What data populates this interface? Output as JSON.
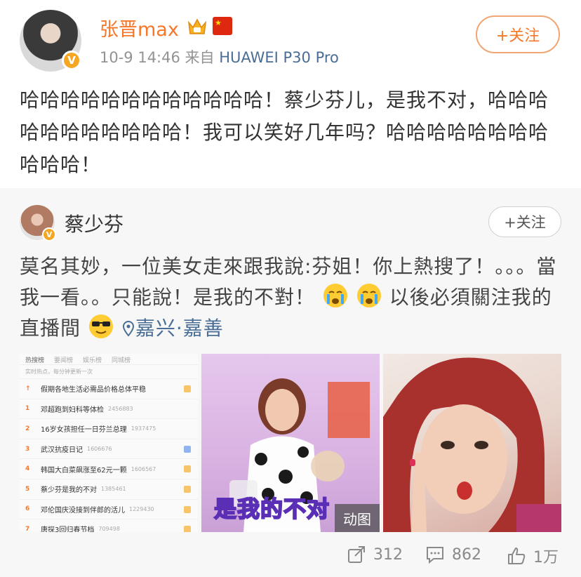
{
  "post": {
    "author": "张晋max",
    "timestamp": "10-9 14:46",
    "source_prefix": "来自",
    "device": "HUAWEI P30 Pro",
    "follow_label": "+关注",
    "text": "哈哈哈哈哈哈哈哈哈哈哈哈！蔡少芬儿，是我不对，哈哈哈哈哈哈哈哈哈哈哈！我可以笑好几年吗？哈哈哈哈哈哈哈哈哈哈哈！"
  },
  "repost": {
    "author": "蔡少芬",
    "follow_label": "+关注",
    "text_part1": "莫名其妙，一位美女走來跟我說:芬姐！你上熱搜了！。。。當我一看。。只能說！是我的不對！",
    "text_part2": "以後必須關注我的直播間",
    "location": "嘉兴·嘉善",
    "images": {
      "hot_search": {
        "tabs": [
          "热搜榜",
          "要闻榜",
          "娱乐榜",
          "同城榜"
        ],
        "subtitle": "实时热点，每分钟更新一次",
        "rows": [
          {
            "rank": "",
            "title": "假期各地生活必需品价格总体平稳",
            "count": ""
          },
          {
            "rank": "1",
            "title": "邓超跑到妇科等体检",
            "count": "2456883"
          },
          {
            "rank": "2",
            "title": "16岁女孩担任一日芬兰总理",
            "count": "1937475"
          },
          {
            "rank": "3",
            "title": "武汉抗疫日记",
            "count": "1606676"
          },
          {
            "rank": "4",
            "title": "韩国大白菜飙涨至62元一颗",
            "count": "1606567"
          },
          {
            "rank": "5",
            "title": "蔡少芬是我的不对",
            "count": "1385461"
          },
          {
            "rank": "6",
            "title": "邓伦国庆没接到伴郎的活儿",
            "count": "1229430"
          },
          {
            "rank": "7",
            "title": "唐探3回归春节档",
            "count": "709498"
          }
        ]
      },
      "gif_caption": "是我的不对",
      "gif_badge": "动图"
    }
  },
  "actions": {
    "repost_count": "312",
    "comment_count": "862",
    "like_count": "1万"
  },
  "colors": {
    "accent": "#f77728",
    "link": "#4a6d96",
    "muted": "#939393"
  }
}
